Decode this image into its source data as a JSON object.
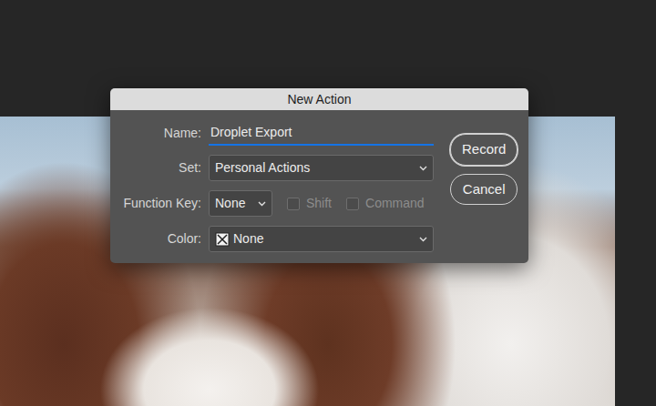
{
  "window": {
    "title": "New Action"
  },
  "fields": [
    {
      "label": "Name:",
      "kind": "text",
      "value": "Droplet Export"
    },
    {
      "label": "Set:",
      "kind": "select",
      "value": "Personal Actions"
    },
    {
      "label": "Function Key:",
      "kind": "function",
      "value": "None",
      "options": [
        {
          "label": "Shift",
          "checked": false,
          "disabled": true
        },
        {
          "label": "Command",
          "checked": false,
          "disabled": true
        }
      ]
    },
    {
      "label": "Color:",
      "kind": "color",
      "value": "None"
    }
  ],
  "buttons": [
    {
      "label": "Record",
      "selected": true
    },
    {
      "label": "Cancel",
      "selected": false
    }
  ]
}
